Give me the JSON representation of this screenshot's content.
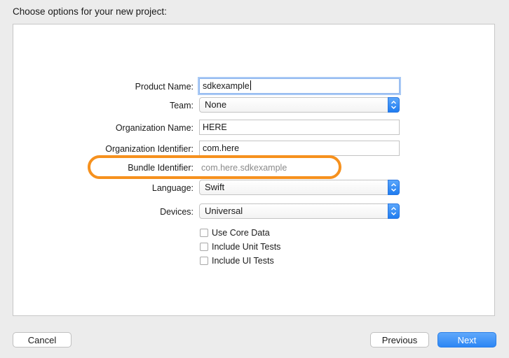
{
  "header": {
    "title": "Choose options for your new project:"
  },
  "form": {
    "product_name": {
      "label": "Product Name:",
      "value": "sdkexample"
    },
    "team": {
      "label": "Team:",
      "value": "None"
    },
    "organization_name": {
      "label": "Organization Name:",
      "value": "HERE"
    },
    "organization_identifier": {
      "label": "Organization Identifier:",
      "value": "com.here"
    },
    "bundle_identifier": {
      "label": "Bundle Identifier:",
      "value": "com.here.sdkexample"
    },
    "language": {
      "label": "Language:",
      "value": "Swift"
    },
    "devices": {
      "label": "Devices:",
      "value": "Universal"
    },
    "options": [
      {
        "label": "Use Core Data",
        "checked": false
      },
      {
        "label": "Include Unit Tests",
        "checked": false
      },
      {
        "label": "Include UI Tests",
        "checked": false
      }
    ]
  },
  "buttons": {
    "cancel": "Cancel",
    "previous": "Previous",
    "next": "Next"
  },
  "colors": {
    "highlight": "#f6911e",
    "accent": "#2c86f4"
  }
}
